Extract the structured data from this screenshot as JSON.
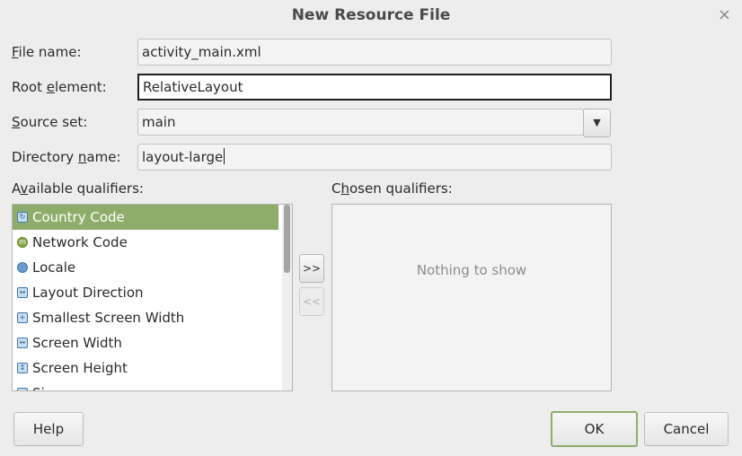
{
  "window": {
    "title": "New Resource File",
    "close_glyph": "×"
  },
  "form": {
    "file_name": {
      "label_mnemonic": "F",
      "label_rest": "ile name:",
      "value": "activity_main.xml"
    },
    "root_element": {
      "label_pre": "Root ",
      "label_mnemonic": "e",
      "label_rest": "lement:",
      "value": "RelativeLayout"
    },
    "source_set": {
      "label_mnemonic": "S",
      "label_rest": "ource set:",
      "value": "main"
    },
    "directory_name": {
      "label_pre": "Directory ",
      "label_mnemonic": "n",
      "label_rest": "ame:",
      "value": "layout-large"
    }
  },
  "available": {
    "label_pre": "A",
    "label_mnemonic": "v",
    "label_rest": "ailable qualifiers:",
    "items": [
      {
        "label": "Country Code",
        "icon": "country-code-icon",
        "selected": true
      },
      {
        "label": "Network Code",
        "icon": "network-code-icon"
      },
      {
        "label": "Locale",
        "icon": "locale-globe-icon"
      },
      {
        "label": "Layout Direction",
        "icon": "layout-direction-icon"
      },
      {
        "label": "Smallest Screen Width",
        "icon": "smallest-screen-width-icon"
      },
      {
        "label": "Screen Width",
        "icon": "screen-width-icon"
      },
      {
        "label": "Screen Height",
        "icon": "screen-height-icon"
      },
      {
        "label": "Si",
        "icon": "size-icon"
      }
    ]
  },
  "chosen": {
    "label_pre": "C",
    "label_mnemonic": "h",
    "label_rest": "osen qualifiers:",
    "empty_text": "Nothing to show"
  },
  "transfer": {
    "add_label": ">>",
    "remove_label": "<<"
  },
  "buttons": {
    "help": "Help",
    "ok": "OK",
    "cancel": "Cancel"
  },
  "colors": {
    "selection": "#8ead6a",
    "default_button_border": "#8eae6c"
  }
}
